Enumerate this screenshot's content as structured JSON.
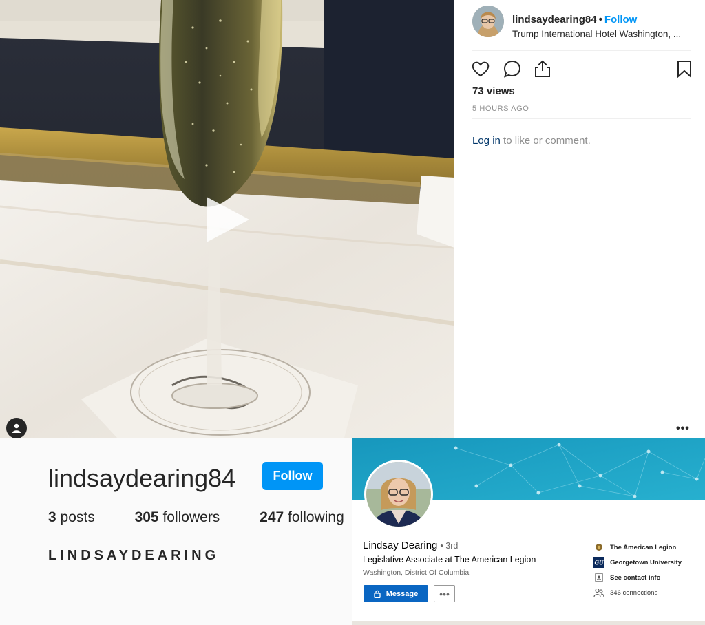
{
  "post": {
    "username": "lindsaydearing84",
    "separator": "•",
    "follow_label": "Follow",
    "location": "Trump International Hotel Washington, ...",
    "views": "73 views",
    "time_ago": "5 HOURS AGO",
    "login_link": "Log in",
    "login_suffix": " to like or comment.",
    "more_icon": "more-options-icon",
    "icons": [
      "heart-icon",
      "comment-icon",
      "share-icon",
      "bookmark-icon",
      "play-icon",
      "user-tag-icon"
    ]
  },
  "profile": {
    "username": "lindsaydearing84",
    "follow_label": "Follow",
    "posts_count": "3",
    "posts_label": " posts",
    "followers_count": "305",
    "followers_label": " followers",
    "following_count": "247",
    "following_label": " following",
    "full_name": "LINDSAYDEARING"
  },
  "linkedin": {
    "name": "Lindsay Dearing",
    "degree": "• 3rd",
    "headline": "Legislative Associate at The American Legion",
    "location": "Washington, District Of Columbia",
    "message_label": "Message",
    "more_label": "•••",
    "org1": "The American Legion",
    "org2": "Georgetown University",
    "contact": "See contact info",
    "connections": "346 connections",
    "colors": {
      "primary": "#0a66c2",
      "banner": "#1aa3c6"
    }
  },
  "colors": {
    "instagram_blue": "#0095f6",
    "text": "#262626",
    "muted": "#8e8e8e"
  }
}
